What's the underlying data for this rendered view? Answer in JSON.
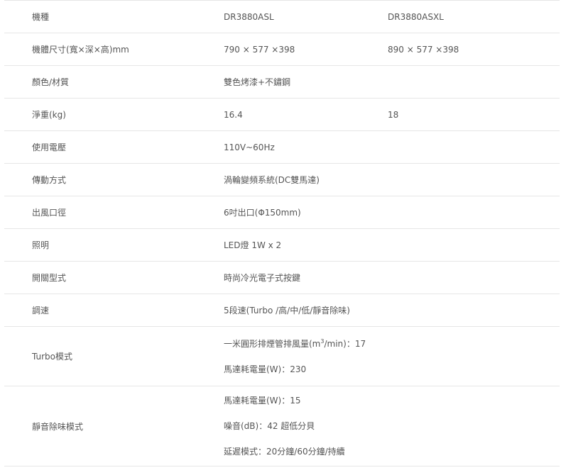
{
  "rows": [
    {
      "label": "機種",
      "a": "DR3880ASL",
      "b": "DR3880ASXL"
    },
    {
      "label": "機體尺寸(寬×深×高)mm",
      "a": "790 × 577 ×398",
      "b": "890 × 577 ×398"
    },
    {
      "label": "顏色/材質",
      "a": "雙色烤漆+不鏽鋼",
      "b": ""
    },
    {
      "label": "淨重(kg)",
      "a": "16.4",
      "b": "18"
    },
    {
      "label": "使用電壓",
      "a": "110V~60Hz",
      "b": ""
    },
    {
      "label": "傳動方式",
      "a": "渦輪變頻系統(DC雙馬達)",
      "b": ""
    },
    {
      "label": "出風口徑",
      "a": "6吋出口(Φ150mm)",
      "b": ""
    },
    {
      "label": "照明",
      "a": "LED燈 1W x 2",
      "b": ""
    },
    {
      "label": "開關型式",
      "a": "時尚冷光電子式按鍵",
      "b": ""
    },
    {
      "label": "調速",
      "a": "5段速(Turbo /高/中/低/靜音除味)",
      "b": ""
    }
  ],
  "turbo": {
    "label": "Turbo模式",
    "line1_prefix": "一米圓形排煙管排風量(m",
    "line1_sup": "3",
    "line1_suffix": "/min)：17",
    "line2": "馬達耗電量(W)：230"
  },
  "quiet": {
    "label": "靜音除味模式",
    "lines": [
      "馬達耗電量(W)：15",
      "噪音(dB)：42 超低分貝",
      "延遲模式：20分鐘/60分鐘/持續"
    ]
  }
}
